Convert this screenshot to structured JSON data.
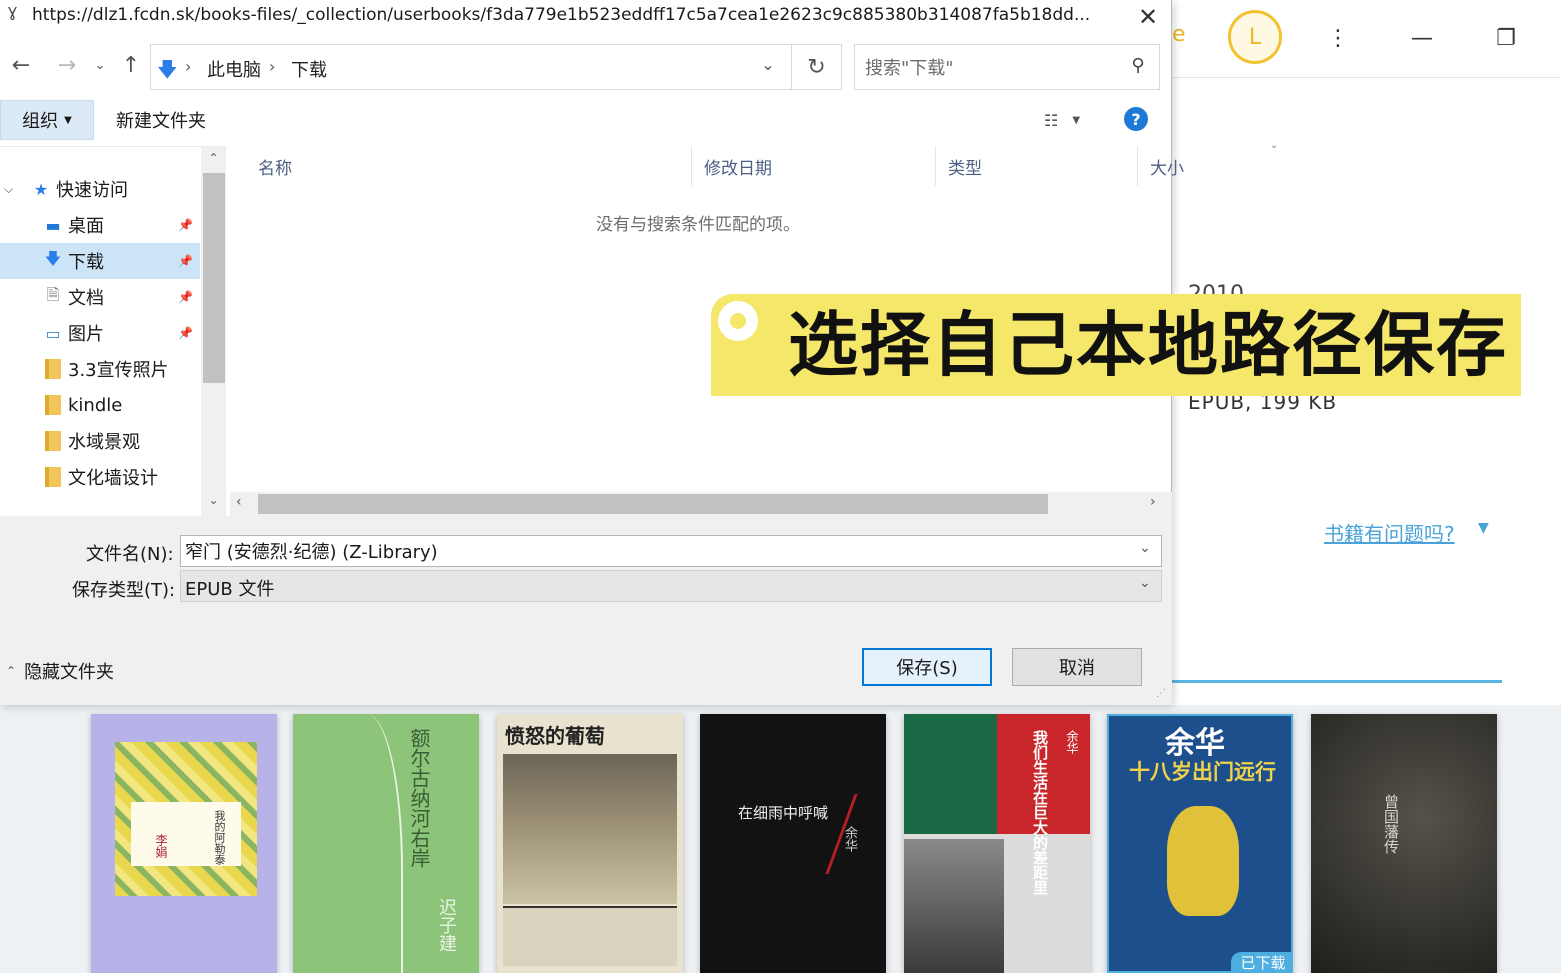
{
  "dialog": {
    "title": "https://dlz1.fcdn.sk/books-files/_collection/userbooks/f3da779e1b523eddff17c5a7cea1e2623c9c885380b314087fa5b18dd...",
    "address": {
      "segments": [
        "此电脑",
        "下载"
      ]
    },
    "search": {
      "placeholder": "搜索\"下载\""
    },
    "toolbar": {
      "organize": "组织",
      "new_folder": "新建文件夹"
    },
    "nav": {
      "quick_access": "快速访问",
      "items": [
        {
          "label": "桌面",
          "pinned": true
        },
        {
          "label": "下载",
          "pinned": true,
          "selected": true
        },
        {
          "label": "文档",
          "pinned": true
        },
        {
          "label": "图片",
          "pinned": true
        },
        {
          "label": "3.3宣传照片"
        },
        {
          "label": "kindle"
        },
        {
          "label": "水域景观"
        },
        {
          "label": "文化墙设计"
        }
      ]
    },
    "columns": {
      "name": "名称",
      "date": "修改日期",
      "type": "类型",
      "size": "大小"
    },
    "empty_message": "没有与搜索条件匹配的项。",
    "form": {
      "filename_label": "文件名(N):",
      "filename_value": "窄门 (安德烈·纪德) (Z-Library)",
      "filetype_label": "保存类型(T):",
      "filetype_value": "EPUB 文件",
      "hide_folders": "隐藏文件夹",
      "save": "保存(S)",
      "cancel": "取消"
    }
  },
  "background": {
    "avatar_letter": "L",
    "partial_label": "e",
    "year_partial": "2010",
    "file_info": "EPUB, 199 KB",
    "issue_link": "书籍有问题吗?",
    "downloaded_tag": "已下载",
    "books": [
      {
        "title": "我的阿勒泰",
        "author": "李娟"
      },
      {
        "title": "额尔古纳河右岸",
        "author": "迟子建"
      },
      {
        "title": "愤怒的葡萄"
      },
      {
        "title": "在细雨中呼喊",
        "author": "余华"
      },
      {
        "title": "我们生活在巨大的差距里",
        "author": "余华"
      },
      {
        "title": "十八岁出门远行",
        "author": "余华"
      },
      {
        "title": "曾国藩传"
      }
    ]
  },
  "overlay": {
    "banner_text": "选择自己本地路径保存"
  },
  "colors": {
    "accent": "#0078d7",
    "selection": "#cce4f7",
    "banner": "#f5e76a",
    "link": "#49a3d9"
  }
}
